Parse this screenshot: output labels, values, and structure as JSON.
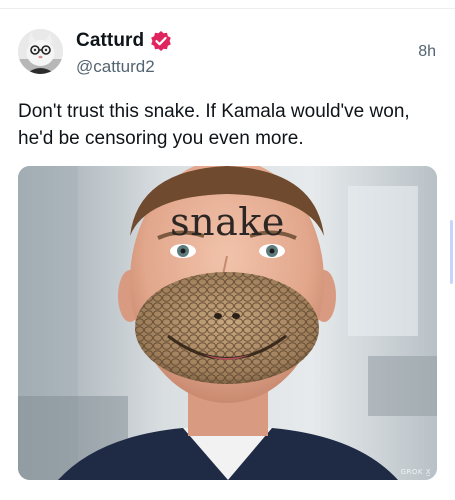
{
  "post": {
    "author_name": "Catturd",
    "handle": "@catturd2",
    "time_ago": "8h",
    "text": "Don't trust this snake. If Kamala would've won, he'd be censoring you even more."
  },
  "media": {
    "forehead_text": "snake",
    "watermark": "GROK X̲"
  },
  "icons": {
    "verified": "verified-badge-icon",
    "avatar": "cat-avatar"
  },
  "colors": {
    "verified_badge": "#e0245e",
    "handle_gray": "#536471"
  }
}
